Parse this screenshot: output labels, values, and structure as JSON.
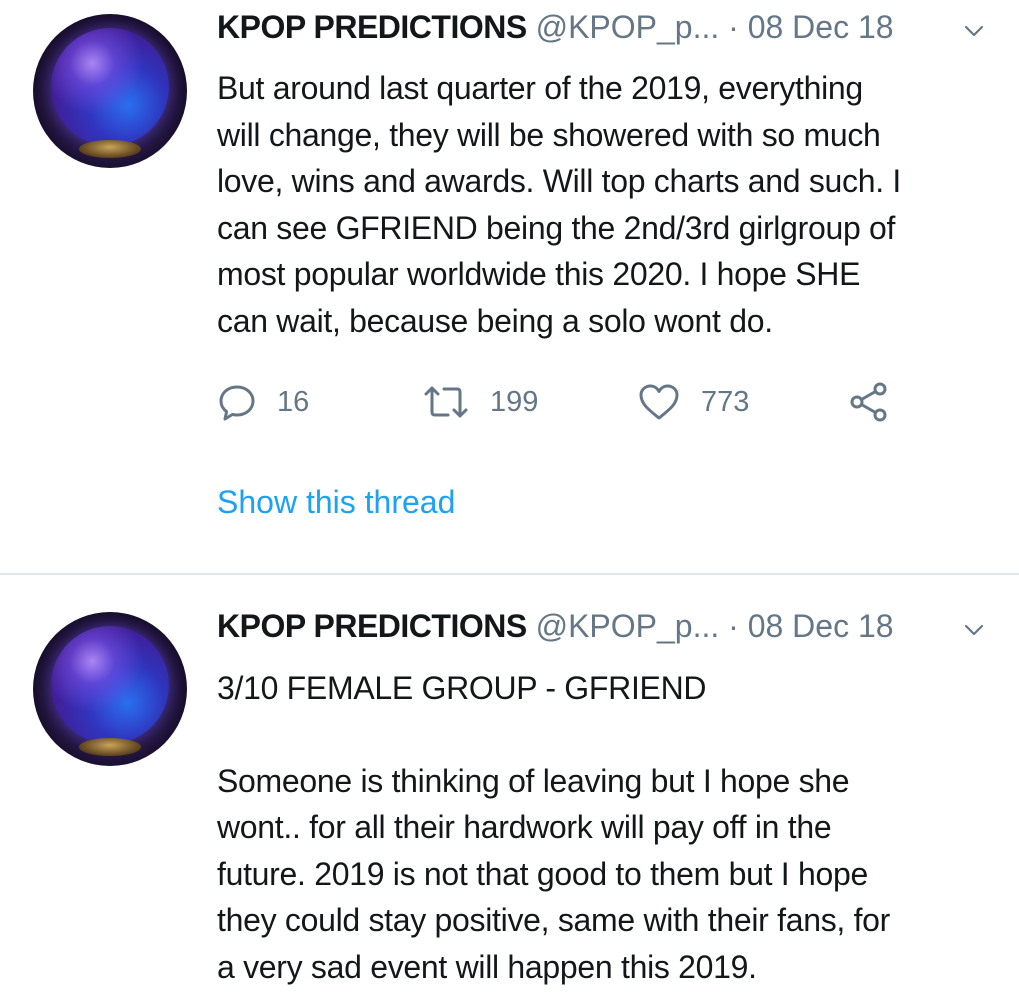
{
  "tweets": [
    {
      "author_name": "KPOP PREDICTIONS",
      "handle": "@KPOP_p...",
      "separator": "·",
      "date": "08 Dec 18",
      "lines": [
        "But around last quarter of the 2019, everything",
        "will change, they will be showered with so much",
        "love, wins and awards. Will top charts and such. I",
        "can see GFRIEND being the 2nd/3rd girlgroup of",
        "most popular worldwide this 2020. I hope SHE",
        "can wait, because being a solo wont do."
      ],
      "replies": "16",
      "retweets": "199",
      "likes": "773",
      "thread_link": "Show this thread"
    },
    {
      "author_name": "KPOP PREDICTIONS",
      "handle": "@KPOP_p...",
      "separator": "·",
      "date": "08 Dec 18",
      "lines": [
        "3/10 FEMALE GROUP - GFRIEND",
        "",
        "Someone is thinking of leaving but I hope she",
        "wont.. for all their hardwork will pay off in the",
        "future. 2019 is not that good to them but I hope",
        "they could stay positive, same with their fans, for",
        "a very sad event will happen this 2019."
      ]
    }
  ],
  "icons": {
    "reply": "reply-bubble-icon",
    "retweet": "retweet-icon",
    "like": "heart-icon",
    "share": "share-icon",
    "more": "chevron-down-icon"
  },
  "colors": {
    "link": "#1da1f2",
    "secondary": "#657786",
    "primary_text": "#14171a",
    "divider": "#e1e8ed"
  }
}
